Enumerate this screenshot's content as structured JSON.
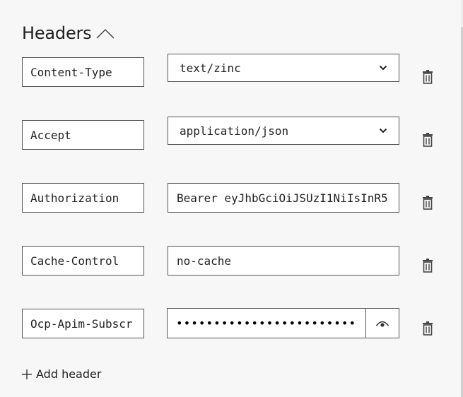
{
  "section": {
    "title": "Headers"
  },
  "headers": [
    {
      "name": "Content-Type",
      "value": "text/zinc",
      "kind": "select"
    },
    {
      "name": "Accept",
      "value": "application/json",
      "kind": "select"
    },
    {
      "name": "Authorization",
      "value": "Bearer eyJhbGciOiJSUzI1NiIsInR5",
      "kind": "text"
    },
    {
      "name": "Cache-Control",
      "value": "no-cache",
      "kind": "text"
    },
    {
      "name": "Ocp-Apim-Subscr",
      "value": "••••••••••••••••••••••••••",
      "kind": "secret"
    }
  ],
  "actions": {
    "add_header_label": "Add header"
  },
  "icons": {
    "collapse": "chevron-up-icon",
    "dropdown": "chevron-down-icon",
    "delete": "trash-icon",
    "reveal": "eye-icon",
    "add": "plus-icon"
  }
}
